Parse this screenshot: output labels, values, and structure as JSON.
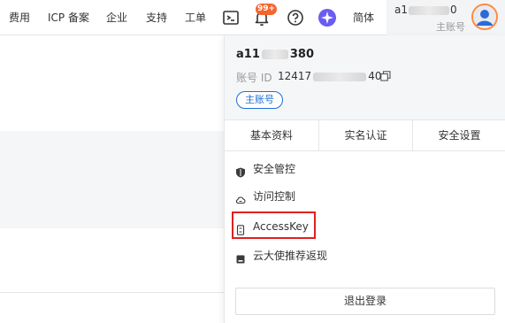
{
  "topbar": {
    "items": [
      "费用",
      "ICP 备案",
      "企业",
      "支持",
      "工单"
    ],
    "badge": "99+",
    "lang": "简体",
    "account_prefix": "a1",
    "account_suffix": "0",
    "account_role": "主账号"
  },
  "panel": {
    "name_prefix": "a11",
    "name_suffix": "380",
    "id_label": "账号 ID",
    "id_prefix": "12417",
    "id_suffix": "40",
    "role_tag": "主账号",
    "tabs": [
      "基本资料",
      "实名认证",
      "安全设置"
    ],
    "menu": [
      {
        "label": "安全管控",
        "icon": "shield-icon"
      },
      {
        "label": "访问控制",
        "icon": "cloud-icon"
      },
      {
        "label": "AccessKey",
        "icon": "key-icon"
      },
      {
        "label": "云大使推荐返现",
        "icon": "gift-icon"
      }
    ],
    "logout": "退出登录"
  },
  "colors": {
    "accent": "#1e6fd9",
    "badge": "#f5652d",
    "highlight": "#e02020",
    "avatar_border": "#ff8a3d"
  }
}
